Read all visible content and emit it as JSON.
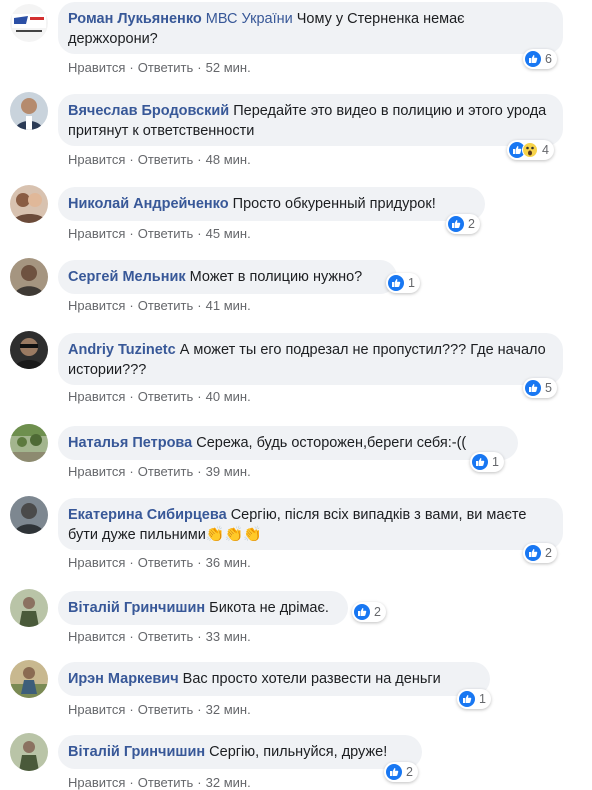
{
  "actions": {
    "like": "Нравится",
    "reply": "Ответить",
    "sep": "·"
  },
  "comments": [
    {
      "author": "Роман Лукьяненко",
      "page_tag": "МВС України",
      "text": "Чому у Стерненка немає держхорони?",
      "time": "52 мин.",
      "reactions": "6"
    },
    {
      "author": "Вячеслав Бродовский",
      "text": "Передайте это видео в полицию и этого урода притянут к ответственности",
      "time": "48 мин.",
      "reactions": "4"
    },
    {
      "author": "Николай Андрейченко",
      "text": "Просто обкуренный придурок!",
      "time": "45 мин.",
      "reactions": "2"
    },
    {
      "author": "Сергей Мельник",
      "text": "Может в полицию нужно?",
      "time": "41 мин.",
      "reactions": "1"
    },
    {
      "author": "Andriy Tuzinetc",
      "text": "А может ты его подрезал не пропустил??? Где начало истории???",
      "time": "40 мин.",
      "reactions": "5"
    },
    {
      "author": "Наталья Петрова",
      "text": "Сережа, будь осторожен,береги себя:-((",
      "time": "39 мин.",
      "reactions": "1"
    },
    {
      "author": "Екатерина Сибирцева",
      "text": "Сергію, після всіх випадків з вами, ви маєте бути дуже пильними",
      "time": "36 мин.",
      "reactions": "2"
    },
    {
      "author": "Віталій Гринчишин",
      "text": "Бикота не дрімає.",
      "time": "33 мин.",
      "reactions": "2"
    },
    {
      "author": "Ирэн Маркевич",
      "text": "Вас просто хотели развести на деньги",
      "time": "32 мин.",
      "reactions": "1"
    },
    {
      "author": "Віталій Гринчишин",
      "text": "Сергію, пильнуйся, друже!",
      "time": "32 мин.",
      "reactions": "2"
    }
  ],
  "colors": {
    "author": "#385898",
    "bubble": "#f0f2f5",
    "like": "#1877f2",
    "meta": "#65676b"
  },
  "icons": [
    "like-icon",
    "wow-icon",
    "clap-emoji"
  ]
}
